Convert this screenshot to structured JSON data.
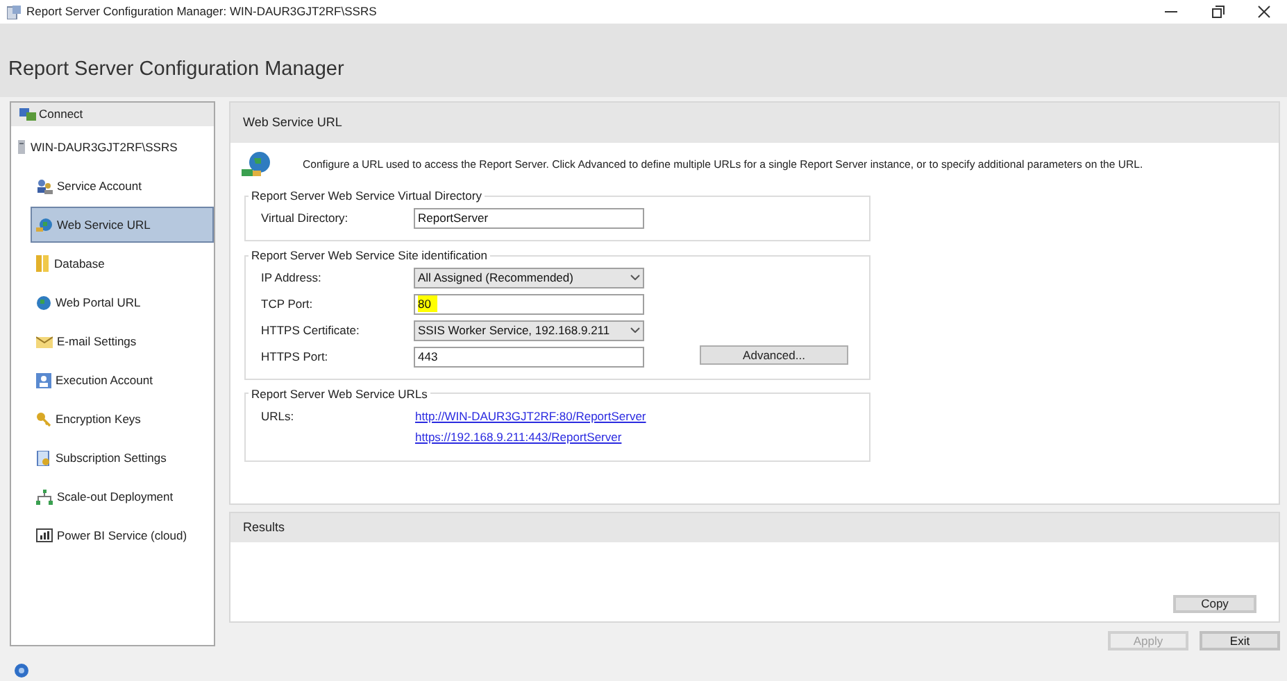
{
  "window": {
    "title": "Report Server Configuration Manager: WIN-DAUR3GJT2RF\\SSRS"
  },
  "header": {
    "title": "Report Server Configuration Manager"
  },
  "sidebar": {
    "connect": "Connect",
    "server": "WIN-DAUR3GJT2RF\\SSRS",
    "items": [
      {
        "label": "Service Account",
        "selected": false
      },
      {
        "label": "Web Service URL",
        "selected": true
      },
      {
        "label": "Database",
        "selected": false
      },
      {
        "label": "Web Portal URL",
        "selected": false
      },
      {
        "label": "E-mail Settings",
        "selected": false
      },
      {
        "label": "Execution Account",
        "selected": false
      },
      {
        "label": "Encryption Keys",
        "selected": false
      },
      {
        "label": "Subscription Settings",
        "selected": false
      },
      {
        "label": "Scale-out Deployment",
        "selected": false
      },
      {
        "label": "Power BI Service (cloud)",
        "selected": false
      }
    ]
  },
  "panel": {
    "title": "Web Service URL",
    "description": "Configure a URL used to access the Report Server.  Click Advanced to define multiple URLs for a single Report Server instance, or to specify additional parameters on the URL.",
    "groups": [
      {
        "title": "Report Server Web Service Virtual Directory",
        "fields": [
          {
            "label": "Virtual Directory:",
            "kind": "text",
            "value": "ReportServer",
            "highlighted": false
          }
        ]
      },
      {
        "title": "Report Server Web Service Site identification",
        "button": "Advanced...",
        "fields": [
          {
            "label": "IP Address:",
            "kind": "dropdown",
            "value": "All Assigned (Recommended)",
            "highlighted": false
          },
          {
            "label": "TCP Port:",
            "kind": "text",
            "value": "80",
            "highlighted": true
          },
          {
            "label": "HTTPS Certificate:",
            "kind": "dropdown",
            "value": "SSIS Worker Service, 192.168.9.211",
            "highlighted": false
          },
          {
            "label": "HTTPS Port:",
            "kind": "text",
            "value": "443",
            "highlighted": false
          }
        ]
      }
    ],
    "urls": {
      "title": "Report Server Web Service URLs",
      "label": "URLs:",
      "links": [
        "http://WIN-DAUR3GJT2RF:80/ReportServer",
        "https://192.168.9.211:443/ReportServer"
      ]
    }
  },
  "results": {
    "title": "Results",
    "copy": "Copy"
  },
  "footer": {
    "buttons": [
      {
        "label": "Apply",
        "disabled": true
      },
      {
        "label": "Exit",
        "disabled": false
      }
    ]
  }
}
